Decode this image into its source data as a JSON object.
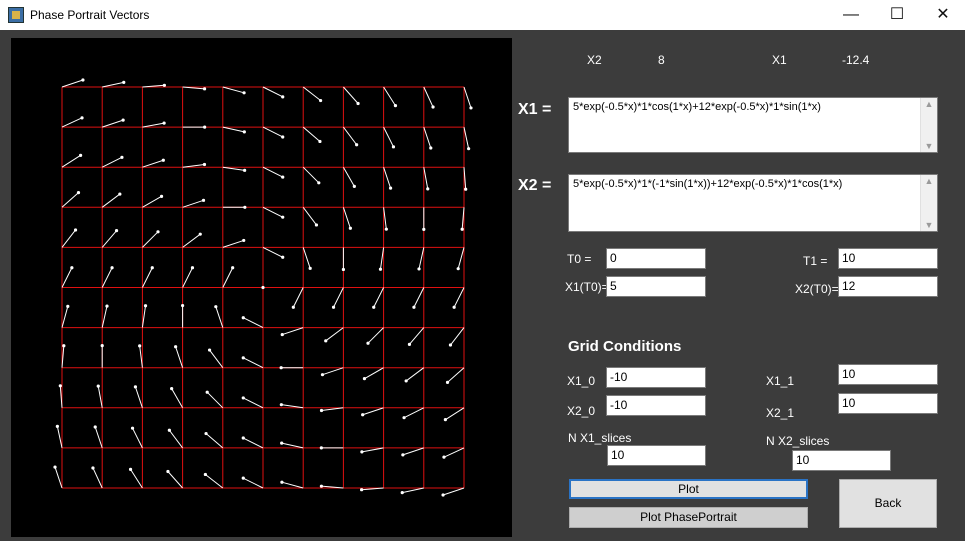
{
  "window": {
    "title": "Phase Portrait Vectors",
    "minimize_glyph": "—",
    "maximize_glyph": "☐",
    "close_glyph": "✕"
  },
  "readout": {
    "x2_label": "X2",
    "x2_value": "8",
    "x1_label": "X1",
    "x1_value": "-12.4"
  },
  "equations": {
    "x1_label": "X1 =",
    "x1_expr": "5*exp(-0.5*x)*1*cos(1*x)+12*exp(-0.5*x)*1*sin(1*x)",
    "x2_label": "X2 =",
    "x2_expr": "5*exp(-0.5*x)*1*(-1*sin(1*x))+12*exp(-0.5*x)*1*cos(1*x)"
  },
  "initial": {
    "t0_label": "T0 =",
    "t0_value": "0",
    "t1_label": "T1 =",
    "t1_value": "10",
    "x1t0_label": "X1(T0)=",
    "x1t0_value": "5",
    "x2t0_label": "X2(T0)=",
    "x2t0_value": "12"
  },
  "grid": {
    "title": "Grid Conditions",
    "x1_0_label": "X1_0",
    "x1_0_value": "-10",
    "x1_1_label": "X1_1",
    "x1_1_value": "10",
    "x2_0_label": "X2_0",
    "x2_0_value": "-10",
    "x2_1_label": "X2_1",
    "x2_1_value": "10",
    "nx1_label": "N X1_slices",
    "nx1_value": "10",
    "nx2_label": "N X2_slices",
    "nx2_value": "10"
  },
  "buttons": {
    "plot": "Plot",
    "plot_phase": "Plot PhasePortrait",
    "back": "Back"
  },
  "colors": {
    "grid_line": "#e01010",
    "vector": "#ffffff",
    "canvas_bg": "#000000",
    "panel_bg": "#3c3c3c"
  },
  "icons": {
    "app": "app-icon",
    "scroll_up": "scroll-up-icon",
    "scroll_down": "scroll-down-icon"
  }
}
